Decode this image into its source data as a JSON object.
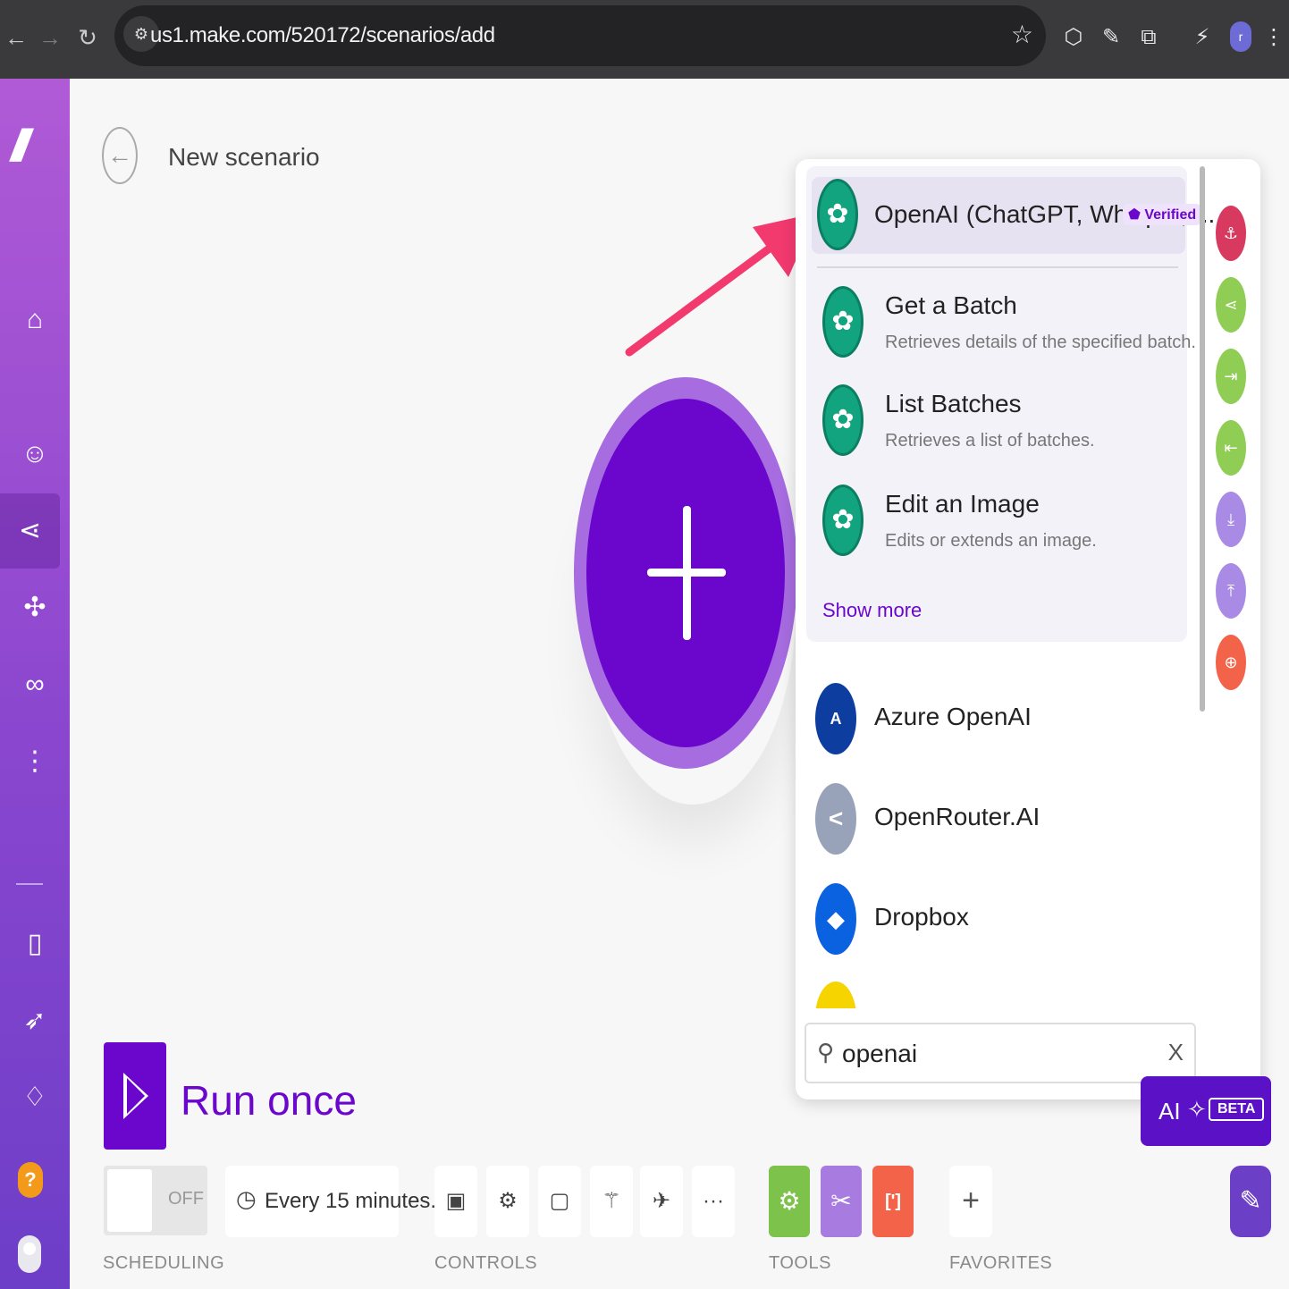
{
  "browser": {
    "url": "us1.make.com/520172/scenarios/add",
    "profile_initial": "r"
  },
  "sidebar": {
    "logo_text": "///",
    "items": [
      {
        "name": "home-icon",
        "glyph": "⌂"
      },
      {
        "name": "team-icon",
        "glyph": "👥"
      },
      {
        "name": "scenarios-icon",
        "glyph": "⋖"
      },
      {
        "name": "apps-icon",
        "glyph": "✣"
      },
      {
        "name": "connections-icon",
        "glyph": "∞"
      },
      {
        "name": "more-icon",
        "glyph": "⋮"
      },
      {
        "name": "docs-icon",
        "glyph": "▯"
      },
      {
        "name": "rocket-icon",
        "glyph": "➶"
      },
      {
        "name": "notifications-icon",
        "glyph": "♫"
      }
    ],
    "help_glyph": "?"
  },
  "header": {
    "title": "New scenario"
  },
  "panel": {
    "group": {
      "app_name": "OpenAI (ChatGPT, Whisper, ...",
      "badge": "Verified",
      "modules": [
        {
          "title": "Get a Batch",
          "desc": "Retrieves details of the specified batch."
        },
        {
          "title": "List Batches",
          "desc": "Retrieves a list of batches."
        },
        {
          "title": "Edit an Image",
          "desc": "Edits or extends an image."
        }
      ],
      "show_more": "Show more"
    },
    "apps": [
      {
        "name": "Azure OpenAI",
        "icon": "A",
        "color": "#0c3d9f"
      },
      {
        "name": "OpenRouter.AI",
        "icon": "<",
        "color": "#98a2b8"
      },
      {
        "name": "Dropbox",
        "icon": "◆",
        "color": "#0b62e0"
      }
    ],
    "search": {
      "value": "openai",
      "clear": "X"
    },
    "rail": [
      {
        "name": "webhooks-icon",
        "color": "#d8395e"
      },
      {
        "name": "router-icon",
        "color": "#8fcd55"
      },
      {
        "name": "iterator-icon",
        "color": "#8fcd55"
      },
      {
        "name": "aggregator-icon",
        "color": "#8fcd55"
      },
      {
        "name": "download-icon",
        "color": "#a98be6"
      },
      {
        "name": "upload-icon",
        "color": "#a98be6"
      },
      {
        "name": "search-plus-icon",
        "color": "#f2634a"
      }
    ]
  },
  "ai_button": {
    "label": "AI",
    "beta": "BETA"
  },
  "bottom": {
    "run_label": "Run once",
    "toggle_label": "OFF",
    "schedule_text": "Every 15 minutes.",
    "labels": {
      "scheduling": "SCHEDULING",
      "controls": "CONTROLS",
      "tools": "TOOLS",
      "favorites": "FAVORITES"
    },
    "tools": [
      {
        "name": "tools-gear-icon",
        "color": "#7dc24b",
        "glyph": "⚙"
      },
      {
        "name": "tools-wrench-icon",
        "color": "#a87be0",
        "glyph": "✂"
      },
      {
        "name": "tools-json-icon",
        "color": "#f2634a",
        "glyph": "[']"
      }
    ],
    "more_glyph": "···",
    "add_glyph": "+"
  }
}
